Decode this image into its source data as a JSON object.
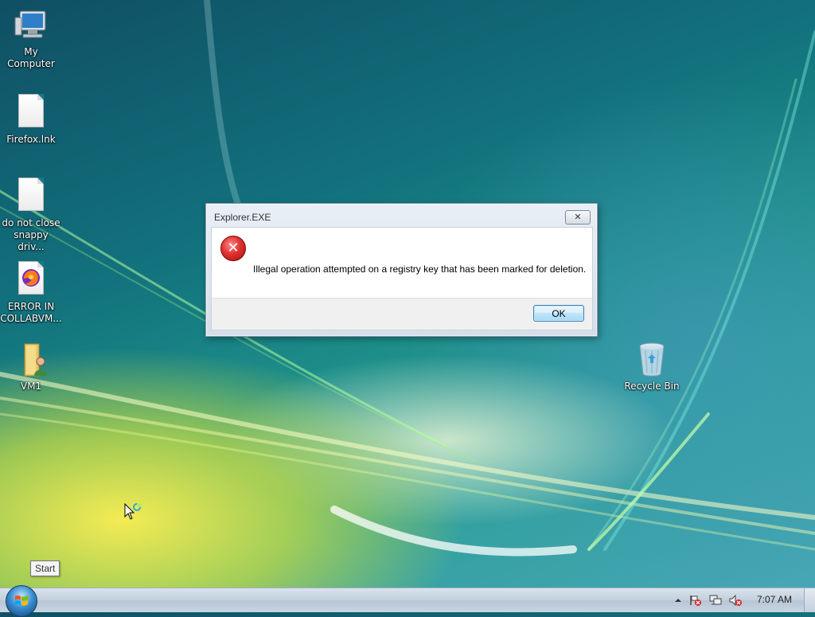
{
  "desktop": {
    "icons": [
      {
        "label": "My Computer",
        "icon": "computer-icon"
      },
      {
        "label": "Firefox.lnk",
        "icon": "file-icon"
      },
      {
        "label": "do not close snappy driv...",
        "icon": "file-icon"
      },
      {
        "label": "ERROR IN COLLABVM...",
        "icon": "firefox-icon"
      },
      {
        "label": "VM1",
        "icon": "user-folder-icon"
      },
      {
        "label": "Recycle Bin",
        "icon": "recycle-bin-icon"
      }
    ]
  },
  "dialog": {
    "title": "Explorer.EXE",
    "close_glyph": "✕",
    "icon": "error-icon",
    "message": "Illegal operation attempted on a registry key that has been marked for deletion.",
    "ok_label": "OK"
  },
  "tooltip": {
    "text": "Start"
  },
  "taskbar": {
    "start": "start-orb",
    "tray_icons": [
      "show-hidden-icons-arrow",
      "action-center-flag-icon",
      "network-icon",
      "volume-muted-icon"
    ],
    "clock": "7:07 AM"
  }
}
